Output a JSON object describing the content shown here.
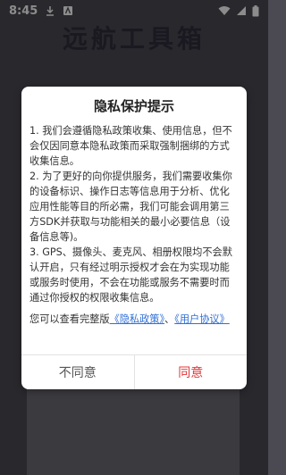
{
  "status_bar": {
    "time": "8:45",
    "icons_left": [
      "download-icon",
      "notification-icon"
    ],
    "icons_right": [
      "wifi-icon",
      "signal-icon",
      "battery-icon"
    ]
  },
  "app": {
    "title": "远航工具箱"
  },
  "dialog": {
    "title": "隐私保护提示",
    "paragraphs": [
      "1. 我们会遵循隐私政策收集、使用信息，但不会仅因同意本隐私政策而采取强制捆绑的方式收集信息。",
      "2. 为了更好的向你提供服务，我们需要收集你的设备标识、操作日志等信息用于分析、优化应用性能等目的所必需，我们可能会调用第三方SDK并获取与功能相关的最小必要信息（设备信息等)。",
      "3. GPS、摄像头、麦克风、相册权限均不会默认开启，只有经过明示授权才会在为实现功能或服务时使用，不会在功能或服务不需要时而通过你授权的权限收集信息。"
    ],
    "footer_prefix": "您可以查看完整版",
    "privacy_link": "《隐私政策》",
    "separator": "、",
    "agreement_link": "《用户协议》",
    "disagree_label": "不同意",
    "agree_label": "同意"
  },
  "colors": {
    "background": "#4b4a52",
    "link": "#2f6fd6",
    "agree": "#e0383b"
  }
}
